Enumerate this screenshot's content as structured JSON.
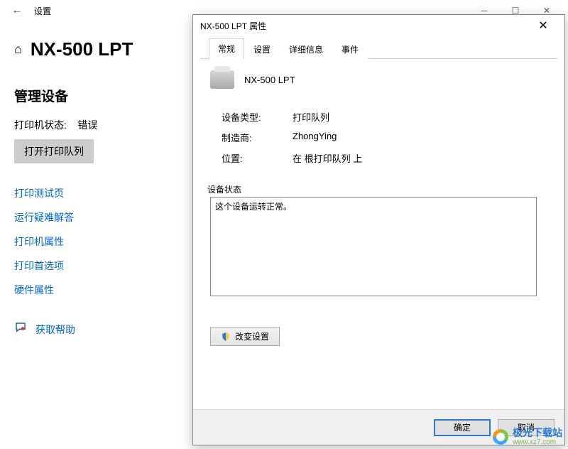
{
  "settings": {
    "title": "设置",
    "device_name": "NX-500 LPT",
    "manage_heading": "管理设备",
    "status_label": "打印机状态:",
    "status_value": "错误",
    "open_queue_btn": "打开打印队列",
    "links": [
      "打印测试页",
      "运行疑难解答",
      "打印机属性",
      "打印首选项",
      "硬件属性"
    ],
    "help_link": "获取帮助"
  },
  "dialog": {
    "title": "NX-500 LPT 属性",
    "tabs": [
      "常规",
      "设置",
      "详细信息",
      "事件"
    ],
    "device_name": "NX-500 LPT",
    "fields": {
      "type_label": "设备类型:",
      "type_value": "打印队列",
      "mfr_label": "制造商:",
      "mfr_value": "ZhongYing",
      "loc_label": "位置:",
      "loc_value": "在 根打印队列 上"
    },
    "status_label": "设备状态",
    "status_text": "这个设备运转正常。",
    "change_btn": "改变设置",
    "ok_btn": "确定",
    "cancel_btn": "取消"
  },
  "watermark": {
    "name": "极光下载站",
    "url": "www.xz7.com"
  }
}
